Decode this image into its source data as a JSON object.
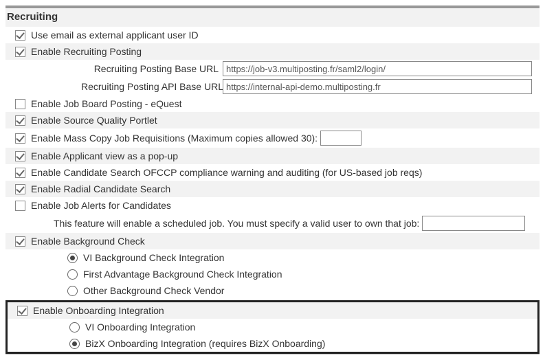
{
  "section_title": "Recruiting",
  "options": {
    "use_email_id": "Use email as external applicant user ID",
    "enable_posting": "Enable Recruiting Posting",
    "posting_base_url_label": "Recruiting Posting Base URL",
    "posting_base_url_value": "https://job-v3.multiposting.fr/saml2/login/",
    "posting_api_url_label": "Recruiting Posting API Base URL",
    "posting_api_url_value": "https://internal-api-demo.multiposting.fr",
    "enable_equest": "Enable Job Board Posting - eQuest",
    "enable_source_quality": "Enable Source Quality Portlet",
    "enable_mass_copy": "Enable Mass Copy Job Requisitions (Maximum copies allowed 30):",
    "mass_copy_value": "",
    "enable_popup": "Enable Applicant view as a pop-up",
    "enable_ofccp": "Enable Candidate Search OFCCP compliance warning and auditing (for US-based job reqs)",
    "enable_radial": "Enable Radial Candidate Search",
    "enable_job_alerts": "Enable Job Alerts for Candidates",
    "job_alerts_note": "This feature will enable a scheduled job. You must specify a valid user to own that job:",
    "job_alerts_user_value": "",
    "enable_bg_check": "Enable Background Check",
    "bg_vi": "VI Background Check Integration",
    "bg_fa": "First Advantage Background Check Integration",
    "bg_other": "Other Background Check Vendor",
    "enable_onboarding": "Enable Onboarding Integration",
    "ob_vi": "VI Onboarding Integration",
    "ob_bizx": "BizX Onboarding Integration (requires BizX Onboarding)"
  }
}
